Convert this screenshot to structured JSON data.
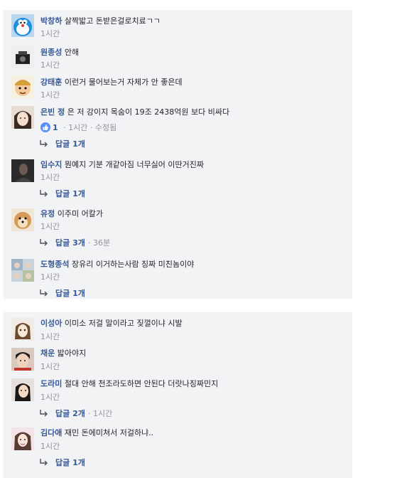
{
  "panel1": [
    {
      "name": "박창하",
      "text": "살짝밟고 돈받은걸로치료ㄱㄱ",
      "time": "1시간"
    },
    {
      "name": "원종성",
      "text": "안해",
      "time": "1시간"
    },
    {
      "name": "강태훈",
      "text": "이런거 물어보는거 자체가 안 좋은데",
      "time": "1시간"
    },
    {
      "name": "은빈 정",
      "text": "은 저 강이지 목숨이 19조 2438억원 보다 비싸다",
      "likes": "1",
      "time": "1시간",
      "edited": "수정됨",
      "reply": "답글 1개"
    },
    {
      "name": "임수지",
      "text": "뭔예지 기분 개같아짐 너무싫어 이딴거진짜",
      "time": "1시간",
      "reply": "답글 1개"
    },
    {
      "name": "유정",
      "text": "이주미 어칼가",
      "time": "1시간",
      "reply": "답글 3개",
      "reply_time": "36분"
    },
    {
      "name": "도형종석",
      "text": "장유리 이거하는사람 징짜 미친놈이야",
      "time": "1시간",
      "reply": "답글 1개"
    }
  ],
  "panel2": [
    {
      "name": "이성아",
      "text": "이미소 저걸 말이라고 짖껄이냐 시발",
      "time": "1시간"
    },
    {
      "name": "채운",
      "text": "밟아야지",
      "time": "1시간"
    },
    {
      "name": "도라미",
      "text": "절대 안해 천조라도하면 안된다 더랏나징짜민지",
      "time": "1시간",
      "reply": "답글 2개",
      "reply_time": "1시간"
    },
    {
      "name": "김다애",
      "text": "재민 돈에미쳐서 저걸하냐..",
      "time": "1시간",
      "reply": "답글 1개"
    }
  ],
  "separator": "·",
  "colors": {
    "panel_bg": "#f2f3f5",
    "name": "#365899",
    "meta": "#90949c",
    "like_blue": "#5890ff"
  },
  "icons": [
    "doraemon-avatar",
    "camera-avatar",
    "cartoon-face-avatar",
    "girl-avatar",
    "dark-avatar",
    "puppy-avatar",
    "collage-avatar",
    "anime-avatar",
    "boy-avatar",
    "woman-avatar",
    "girl-pink-avatar",
    "like-icon",
    "reply-arrow-icon"
  ]
}
